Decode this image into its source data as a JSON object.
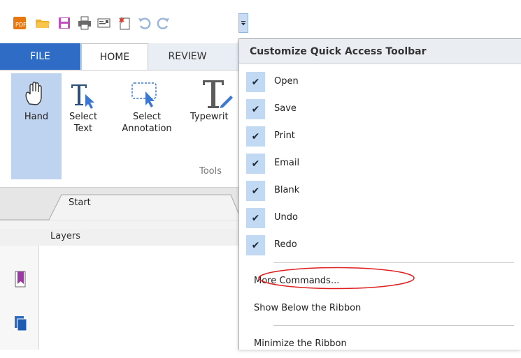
{
  "ribbon_tabs": {
    "file": "FILE",
    "home": "HOME",
    "review": "REVIEW"
  },
  "ribbon_buttons": {
    "hand": "Hand",
    "select_text_1": "Select",
    "select_text_2": "Text",
    "select_annotation_1": "Select",
    "select_annotation_2": "Annotation",
    "typewriter": "Typewrit"
  },
  "ribbon_group": "Tools",
  "doc_tab": "Start",
  "panel_title": "Layers",
  "menu": {
    "title": "Customize Quick Access Toolbar",
    "checked_items": [
      "Open",
      "Save",
      "Print",
      "Email",
      "Blank",
      "Undo",
      "Redo"
    ],
    "more_commands": "More Commands...",
    "show_below": "Show Below the Ribbon",
    "minimize": "Minimize the Ribbon"
  },
  "colors": {
    "file_tab": "#2f6cc6",
    "check_box": "#c2d9f4",
    "hand_selected": "#bed3ef",
    "annotation_ellipse": "#e02020"
  },
  "icons": [
    "app-logo-icon",
    "open-folder-icon",
    "save-icon",
    "print-icon",
    "email-icon",
    "blank-page-icon",
    "undo-icon",
    "redo-icon",
    "qat-dropdown-icon"
  ]
}
